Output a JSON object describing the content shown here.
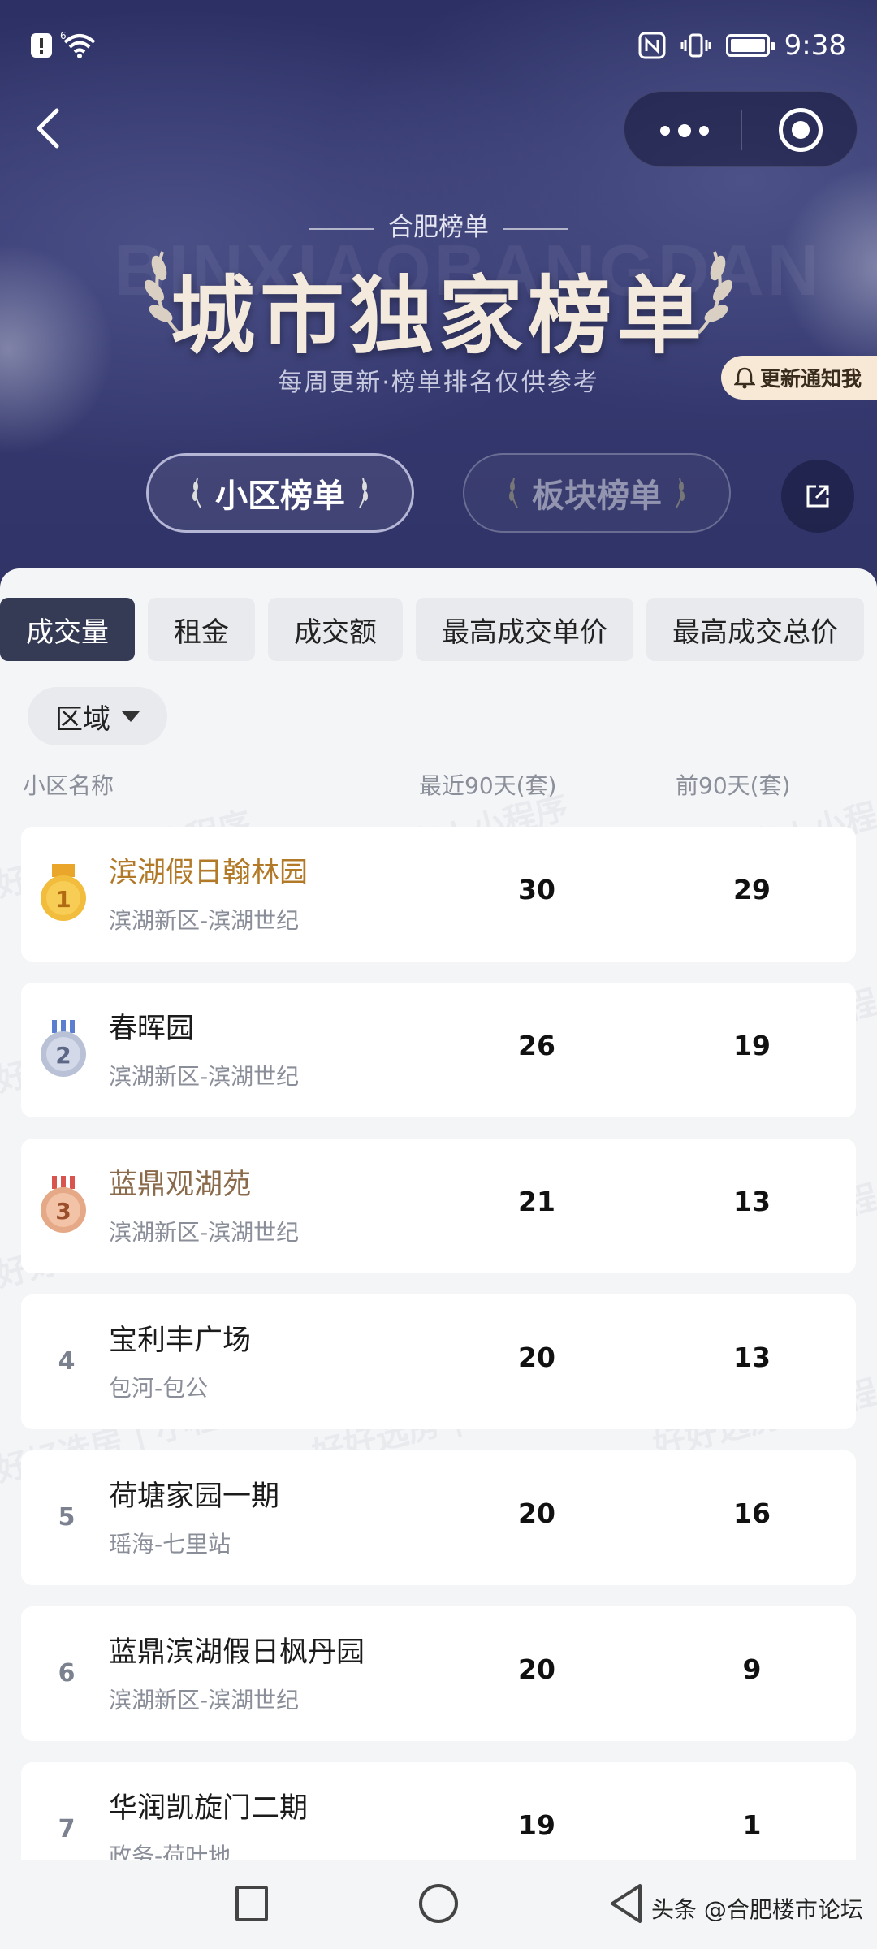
{
  "status_bar": {
    "time": "9:38",
    "signal_superscript": "6",
    "icons": [
      "alert-icon",
      "wifi-icon",
      "nfc-icon",
      "vibrate-icon",
      "battery-icon"
    ]
  },
  "header": {
    "bg_letters": "BINXIAOBANGDAN",
    "kicker": "合肥榜单",
    "title": "城市独家榜单",
    "subtitle": "每周更新·榜单排名仅供参考",
    "notify_label": "更新通知我",
    "toggle": [
      {
        "label": "小区榜单",
        "active": true
      },
      {
        "label": "板块榜单",
        "active": false
      }
    ]
  },
  "tabs": [
    {
      "label": "成交量",
      "active": true
    },
    {
      "label": "租金",
      "active": false
    },
    {
      "label": "成交额",
      "active": false
    },
    {
      "label": "最高成交单价",
      "active": false
    },
    {
      "label": "最高成交总价",
      "active": false
    }
  ],
  "filter": {
    "label": "区域"
  },
  "columns": {
    "name": "小区名称",
    "recent": "最近90天(套)",
    "previous": "前90天(套)"
  },
  "watermark": "好好选房 | 小程序",
  "rows": [
    {
      "rank": "1",
      "medal": "gold",
      "name": "滨湖假日翰林园",
      "area": "滨湖新区-滨湖世纪",
      "recent": "30",
      "previous": "29"
    },
    {
      "rank": "2",
      "medal": "silver",
      "name": "春晖园",
      "area": "滨湖新区-滨湖世纪",
      "recent": "26",
      "previous": "19"
    },
    {
      "rank": "3",
      "medal": "bronze",
      "name": "蓝鼎观湖苑",
      "area": "滨湖新区-滨湖世纪",
      "recent": "21",
      "previous": "13"
    },
    {
      "rank": "4",
      "medal": "",
      "name": "宝利丰广场",
      "area": "包河-包公",
      "recent": "20",
      "previous": "13"
    },
    {
      "rank": "5",
      "medal": "",
      "name": "荷塘家园一期",
      "area": "瑶海-七里站",
      "recent": "20",
      "previous": "16"
    },
    {
      "rank": "6",
      "medal": "",
      "name": "蓝鼎滨湖假日枫丹园",
      "area": "滨湖新区-滨湖世纪",
      "recent": "20",
      "previous": "9"
    },
    {
      "rank": "7",
      "medal": "",
      "name": "华润凯旋门二期",
      "area": "政务-荷叶地",
      "recent": "19",
      "previous": "1"
    }
  ],
  "credit": "头条 @合肥楼市论坛",
  "colors": {
    "gold": "#e9a62a",
    "silver": "#aab3c9",
    "bronze": "#e3a385",
    "accent_dark": "#353a55"
  }
}
